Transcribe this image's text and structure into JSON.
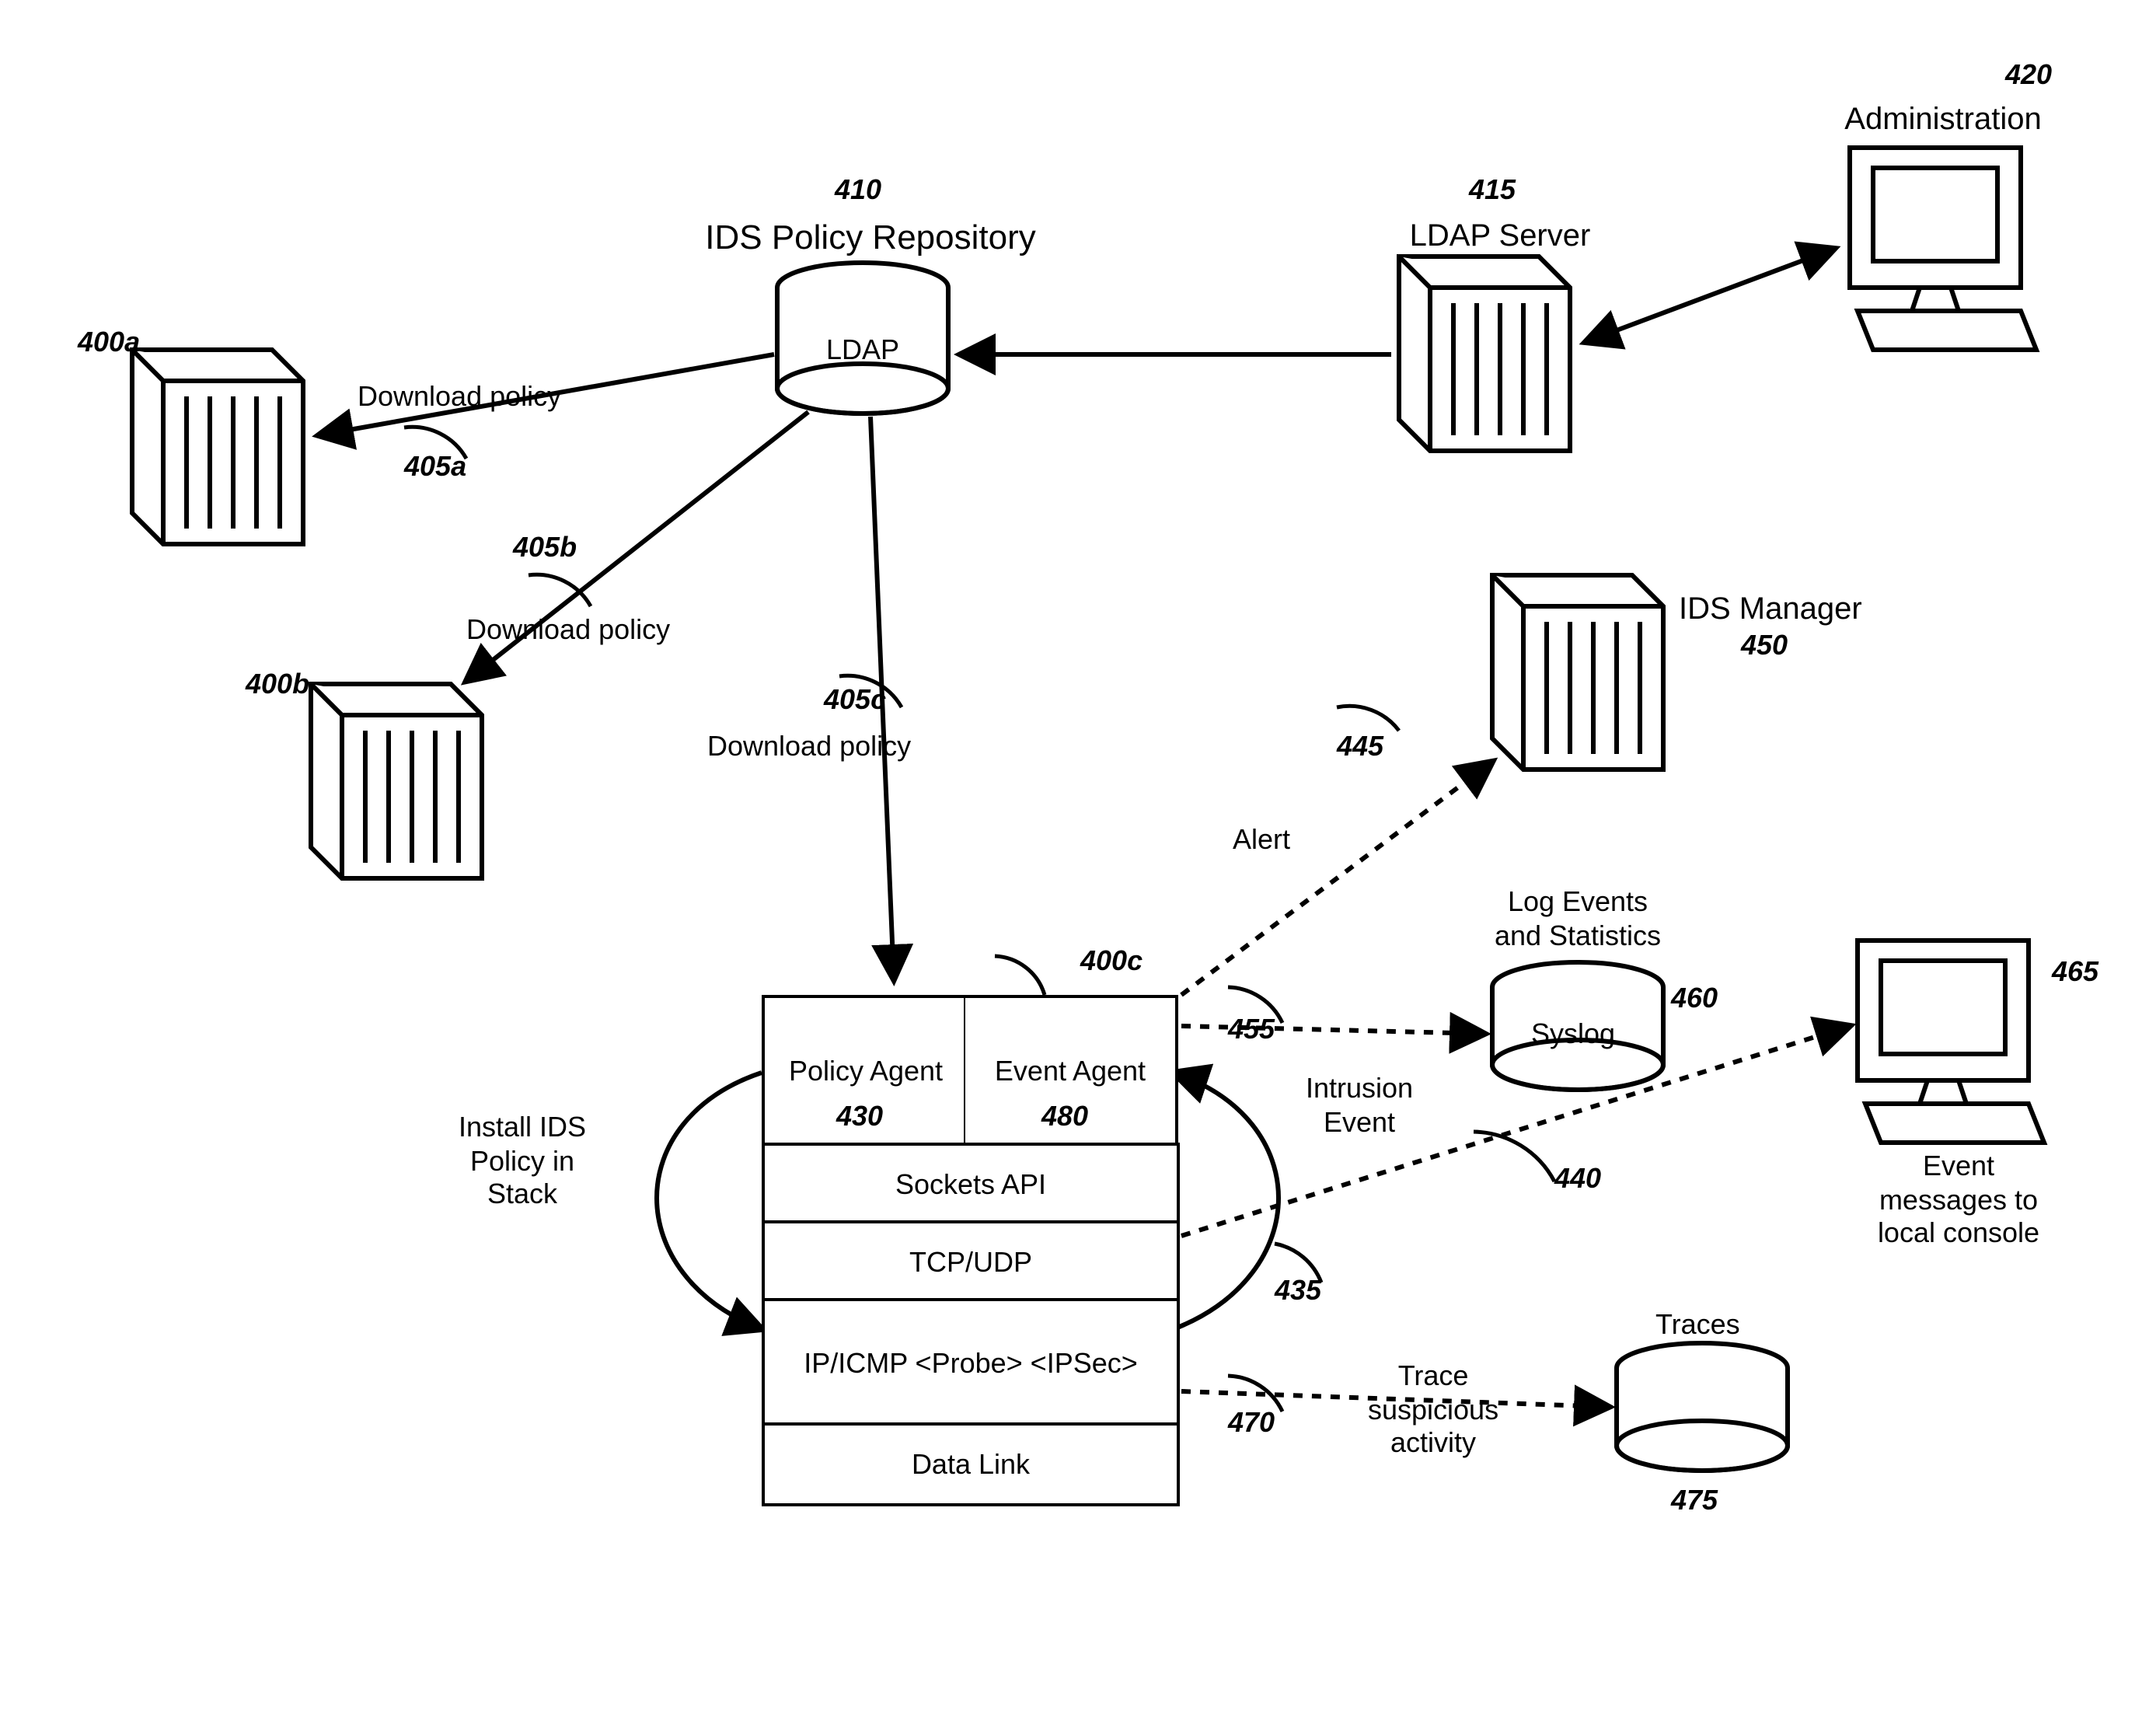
{
  "title_repo": "IDS Policy Repository",
  "ldap": "LDAP",
  "ldap_server": "LDAP Server",
  "administration": "Administration",
  "ids_manager": "IDS Manager",
  "log_events": "Log Events\nand Statistics",
  "syslog": "Syslog",
  "event_msgs": "Event\nmessages to\nlocal console",
  "traces": "Traces",
  "download_policy": "Download policy",
  "install_ids": "Install IDS\nPolicy in\nStack",
  "alert": "Alert",
  "intrusion_event": "Intrusion\nEvent",
  "trace_suspicious": "Trace\nsuspicious\nactivity",
  "stack": {
    "policy_agent": "Policy\nAgent",
    "event_agent": "Event\nAgent",
    "sockets": "Sockets API",
    "tcpudp": "TCP/UDP",
    "ipicmp": "IP/ICMP   <Probe>\n<IPSec>",
    "datalink": "Data Link"
  },
  "refs": {
    "r400a": "400a",
    "r400b": "400b",
    "r400c": "400c",
    "r405a": "405a",
    "r405b": "405b",
    "r405c": "405c",
    "r410": "410",
    "r415": "415",
    "r420": "420",
    "r430": "430",
    "r435": "435",
    "r440": "440",
    "r445": "445",
    "r450": "450",
    "r455": "455",
    "r460": "460",
    "r465": "465",
    "r470": "470",
    "r475": "475",
    "r480": "480"
  }
}
